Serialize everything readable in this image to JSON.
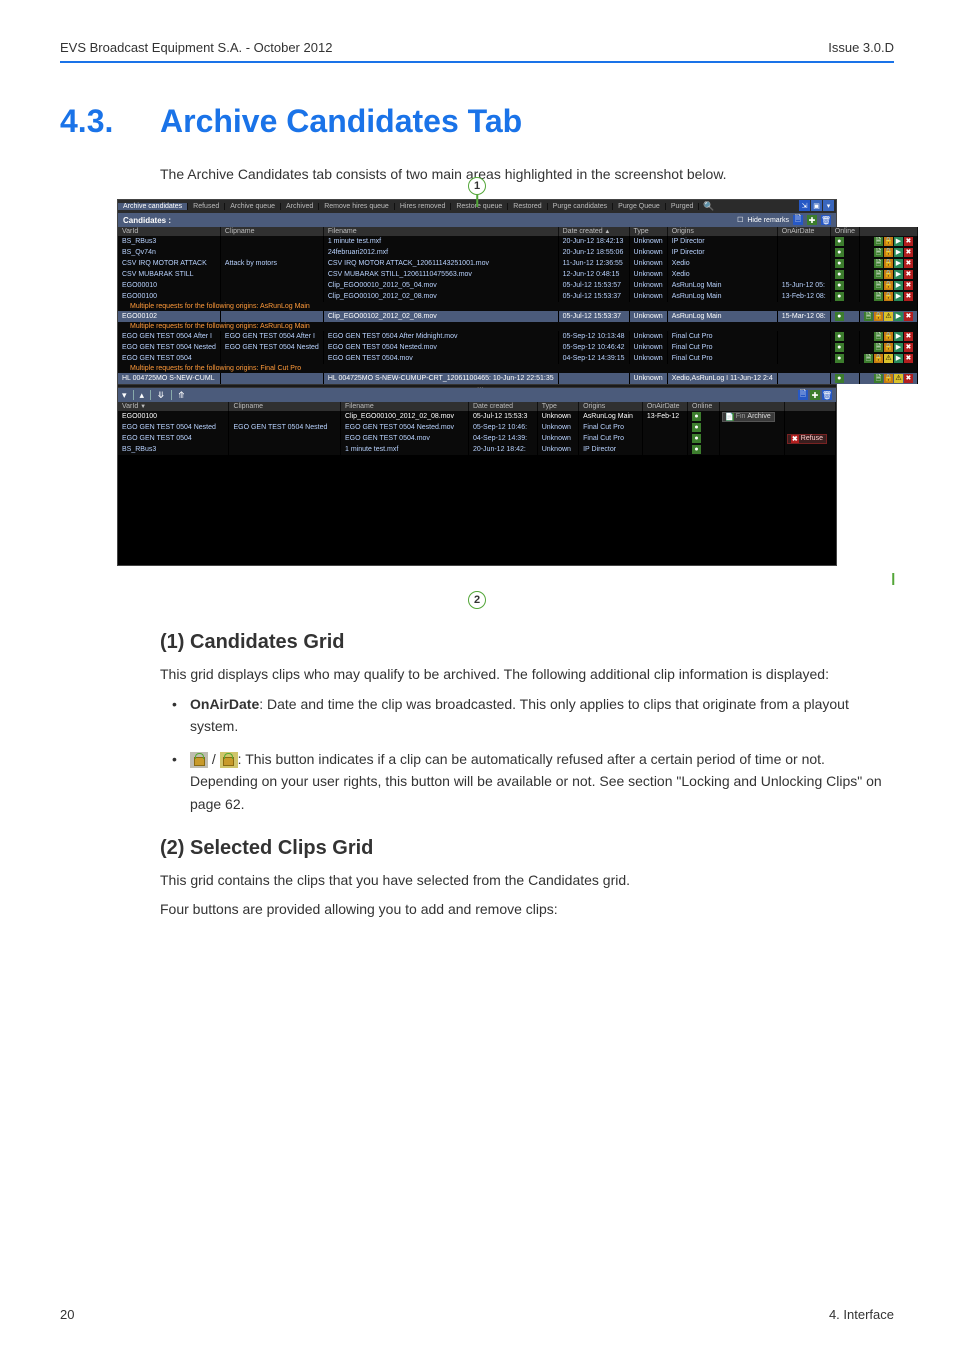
{
  "header": {
    "left": "EVS Broadcast Equipment S.A. - October 2012",
    "right": "Issue 3.0.D"
  },
  "title": {
    "num": "4.3.",
    "text": "Archive Candidates Tab"
  },
  "intro": "The Archive Candidates tab consists of two main areas highlighted in the screenshot below.",
  "callouts": {
    "one": "1",
    "two": "2"
  },
  "tabs": [
    "Archive candidates",
    "Refused",
    "Archive queue",
    "Archived",
    "Remove hires queue",
    "Hires removed",
    "Restore queue",
    "Restored",
    "Purge candidates",
    "Purge Queue",
    "Purged"
  ],
  "panel1": {
    "label": "Candidates :",
    "hide_remarks": "Hide remarks",
    "columns": [
      "VarId",
      "Clipname",
      "Filename",
      "Date created",
      "Type",
      "Origins",
      "OnAirDate",
      "Online",
      ""
    ],
    "rows": [
      {
        "varid": "BS_RBus3",
        "clip": "",
        "file": "1 minute test.mxf",
        "date": "20-Jun-12 18:42:13",
        "type": "Unknown",
        "orig": "IP Director",
        "oad": "",
        "icons": [
          "g",
          "o",
          "tr",
          "r"
        ]
      },
      {
        "varid": "BS_Qv74n",
        "clip": "",
        "file": "24februari2012.mxf",
        "date": "20-Jun-12 18:55:06",
        "type": "Unknown",
        "orig": "IP Director",
        "oad": "",
        "icons": [
          "g",
          "o",
          "tr",
          "r"
        ]
      },
      {
        "varid": "CSV IRQ MOTOR ATTACK",
        "clip": "Attack by motors",
        "file": "CSV IRQ MOTOR ATTACK_120611143251001.mov",
        "date": "11-Jun-12 12:36:55",
        "type": "Unknown",
        "orig": "Xedio",
        "oad": "",
        "icons": [
          "g",
          "o",
          "tr",
          "r"
        ]
      },
      {
        "varid": "CSV MUBARAK STILL",
        "clip": "",
        "file": "CSV MUBARAK STILL_12061110475563.mov",
        "date": "12-Jun-12 0:48:15",
        "type": "Unknown",
        "orig": "Xedio",
        "oad": "",
        "icons": [
          "g",
          "o",
          "tr",
          "r"
        ]
      },
      {
        "varid": "EGO00010",
        "clip": "",
        "file": "Clip_EGO00010_2012_05_04.mov",
        "date": "05-Jul-12 15:53:57",
        "type": "Unknown",
        "orig": "AsRunLog Main",
        "oad": "15-Jun-12 05:",
        "icons": [
          "g",
          "o",
          "tr",
          "r"
        ]
      },
      {
        "varid": "EGO00100",
        "clip": "",
        "file": "Clip_EGO00100_2012_02_08.mov",
        "date": "05-Jul-12 15:53:37",
        "type": "Unknown",
        "orig": "AsRunLog Main",
        "oad": "13-Feb-12 08:",
        "icons": [
          "g",
          "o",
          "tr",
          "r"
        ]
      },
      {
        "multi": "Multiple requests for the following origins: AsRunLog Main"
      },
      {
        "varid": "EGO00102",
        "clip": "",
        "file": "Clip_EGO00102_2012_02_08.mov",
        "date": "05-Jul-12 15:53:37",
        "type": "Unknown",
        "orig": "AsRunLog Main",
        "oad": "15-Mar-12 08:",
        "sel": true,
        "icons": [
          "g",
          "o",
          "y",
          "tr",
          "r"
        ]
      },
      {
        "multi": "Multiple requests for the following origins: AsRunLog Main"
      },
      {
        "varid": "EGO GEN TEST 0504 After I",
        "clip": "EGO GEN TEST 0504 After I",
        "file": "EGO GEN TEST 0504 After Midnight.mov",
        "date": "05-Sep-12 10:13:48",
        "type": "Unknown",
        "orig": "Final Cut Pro",
        "oad": "",
        "icons": [
          "g",
          "o",
          "tr",
          "r"
        ]
      },
      {
        "varid": "EGO GEN TEST 0504 Nested",
        "clip": "EGO GEN TEST 0504 Nested",
        "file": "EGO GEN TEST 0504 Nested.mov",
        "date": "05-Sep-12 10:46:42",
        "type": "Unknown",
        "orig": "Final Cut Pro",
        "oad": "",
        "icons": [
          "g",
          "o",
          "tr",
          "r"
        ]
      },
      {
        "varid": "EGO GEN TEST 0504",
        "clip": "",
        "file": "EGO GEN TEST 0504.mov",
        "date": "04-Sep-12 14:39:15",
        "type": "Unknown",
        "orig": "Final Cut Pro",
        "oad": "",
        "icons": [
          "g",
          "o",
          "y",
          "tr",
          "r"
        ]
      },
      {
        "multi": "Multiple requests for the following origins: Final Cut Pro"
      },
      {
        "varid": "HL 004725MO S-NEW-CUML",
        "clip": "",
        "file": "HL 004725MO S-NEW-CUMUP-CRT_12061100465: 10-Jun-12 22:51:35",
        "date": "",
        "type": "Unknown",
        "orig": "Xedio,AsRunLog I 11-Jun-12 2:4",
        "oad": "",
        "sel": true,
        "icons": [
          "g",
          "o",
          "y",
          "r"
        ]
      }
    ]
  },
  "panel2": {
    "columns": [
      "VarId",
      "Clipname",
      "Filename",
      "Date created",
      "Type",
      "Origins",
      "OnAirDate",
      "Online",
      "",
      ""
    ],
    "rows": [
      {
        "varid": "EGO00100",
        "clip": "",
        "file": "Clip_EGO00100_2012_02_08.mov",
        "date": "05-Jul-12 15:53:3",
        "type": "Unknown",
        "orig": "AsRunLog Main",
        "oad": "13-Feb-12",
        "online": "g",
        "sel": true,
        "archive": true
      },
      {
        "varid": "EGO GEN TEST 0504 Nested",
        "clip": "EGO GEN TEST 0504 Nested",
        "file": "EGO GEN TEST 0504 Nested.mov",
        "date": "05-Sep-12 10:46:",
        "type": "Unknown",
        "orig": "Final Cut Pro",
        "oad": "",
        "online": "g"
      },
      {
        "varid": "EGO GEN TEST 0504",
        "clip": "",
        "file": "EGO GEN TEST 0504.mov",
        "date": "04-Sep-12 14:39:",
        "type": "Unknown",
        "orig": "Final Cut Pro",
        "oad": "",
        "online": "g",
        "refuse": true
      },
      {
        "varid": "BS_RBus3",
        "clip": "",
        "file": "1 minute test.mxf",
        "date": "20-Jun-12 18:42:",
        "type": "Unknown",
        "orig": "IP Director",
        "oad": "",
        "online": "g"
      }
    ],
    "archive_label": "Archive",
    "archive_prefix": "Fin",
    "refuse_label": "Refuse"
  },
  "sub1": {
    "heading": "(1) Candidates Grid",
    "p1": "This grid displays clips who may qualify to be archived. The following additional clip information is displayed:",
    "b1_lead": "OnAirDate",
    "b1_rest": ": Date and time the clip was broadcasted. This only applies to clips that originate from a playout system.",
    "b2_mid": " / ",
    "b2_rest": ": This button indicates if a clip can be automatically refused after a certain period of time or not. Depending on your user rights, this button will be available or not. See section \"Locking and Unlocking Clips\" on page 62."
  },
  "sub2": {
    "heading": "(2) Selected Clips Grid",
    "p1": "This grid contains the clips that you have selected from the Candidates grid.",
    "p2": "Four buttons are provided allowing you to add and remove clips:"
  },
  "footer": {
    "left": "20",
    "right": "4. Interface"
  }
}
